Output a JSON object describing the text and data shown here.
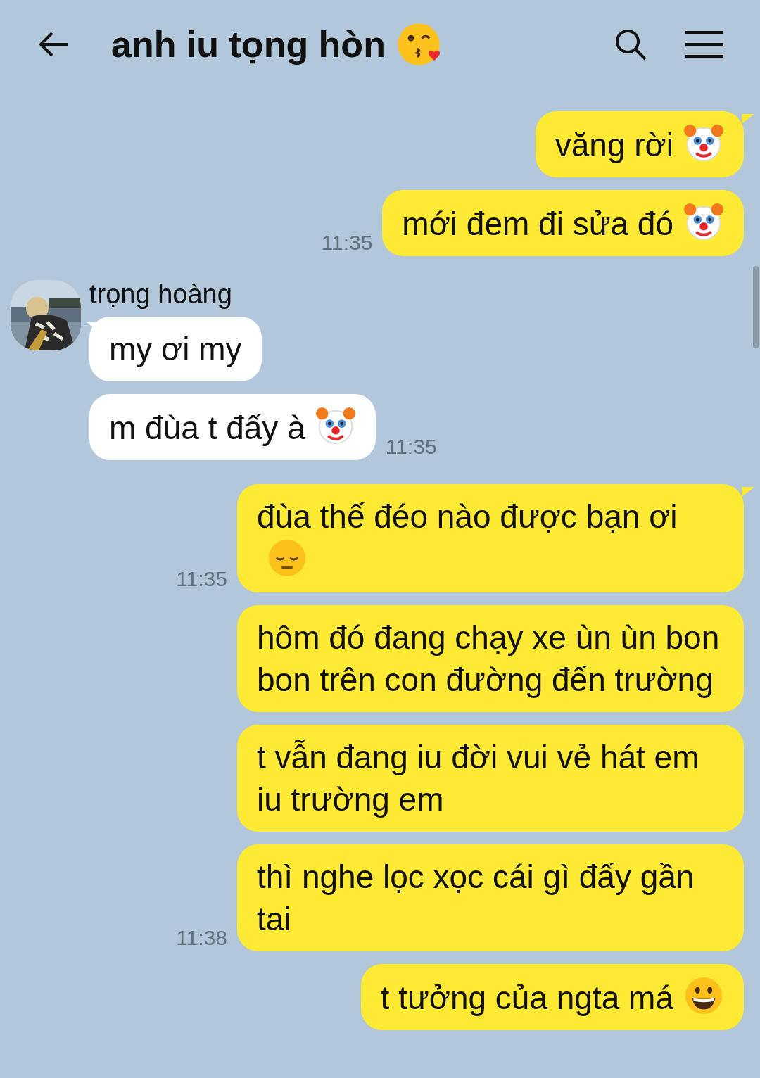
{
  "header": {
    "title": "anh iu tọng hòn"
  },
  "messages": [
    {
      "outgoing": true,
      "tail": true,
      "text": "văng rời",
      "kind": "clown"
    },
    {
      "outgoing": true,
      "tail": false,
      "text": "mới đem đi sửa đó",
      "kind": "clown",
      "time": "11:35"
    },
    {
      "outgoing": false,
      "tail": true,
      "sender": "trọng hoàng",
      "text": "my ơi my",
      "kind": "plain"
    },
    {
      "outgoing": false,
      "tail": false,
      "text": "m đùa t đấy à",
      "kind": "clown",
      "time": "11:35"
    },
    {
      "outgoing": true,
      "tail": true,
      "text": "đùa thế đéo nào được bạn ơi",
      "kind": "pensive",
      "time": "11:35"
    },
    {
      "outgoing": true,
      "tail": false,
      "text": "hôm đó đang chạy xe ùn ùn bon bon trên con đường đến trường",
      "kind": "plain"
    },
    {
      "outgoing": true,
      "tail": false,
      "text": "t vẫn đang iu đời vui vẻ hát em iu trường em",
      "kind": "plain"
    },
    {
      "outgoing": true,
      "tail": false,
      "text": "thì nghe lọc xọc cái gì đấy gần tai",
      "kind": "plain",
      "time": "11:38"
    },
    {
      "outgoing": true,
      "tail": false,
      "text": "t tưởng của ngta má",
      "kind": "grin"
    }
  ]
}
